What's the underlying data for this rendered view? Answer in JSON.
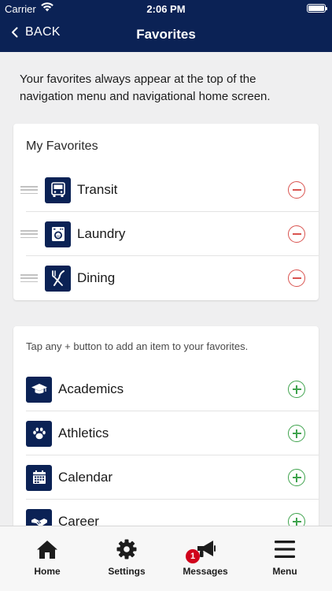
{
  "status_bar": {
    "carrier": "Carrier",
    "time": "2:06 PM"
  },
  "nav": {
    "back_label": "BACK",
    "title": "Favorites"
  },
  "intro_text": "Your favorites always appear at the top of the navigation menu and navigational home screen.",
  "favorites": {
    "title": "My Favorites",
    "items": [
      {
        "label": "Transit",
        "icon": "bus-icon"
      },
      {
        "label": "Laundry",
        "icon": "washing-machine-icon"
      },
      {
        "label": "Dining",
        "icon": "fork-knife-icon"
      }
    ]
  },
  "available": {
    "hint": "Tap any + button to add an item to your favorites.",
    "items": [
      {
        "label": "Academics",
        "icon": "graduation-cap-icon"
      },
      {
        "label": "Athletics",
        "icon": "paw-icon"
      },
      {
        "label": "Calendar",
        "icon": "calendar-icon"
      },
      {
        "label": "Career",
        "icon": "handshake-icon"
      }
    ]
  },
  "tabbar": {
    "home": "Home",
    "settings": "Settings",
    "messages": "Messages",
    "messages_badge": "1",
    "menu": "Menu"
  },
  "colors": {
    "nav_bg": "#0b2255",
    "remove": "#d9534f",
    "add": "#3fa34d",
    "badge": "#d0021b"
  }
}
